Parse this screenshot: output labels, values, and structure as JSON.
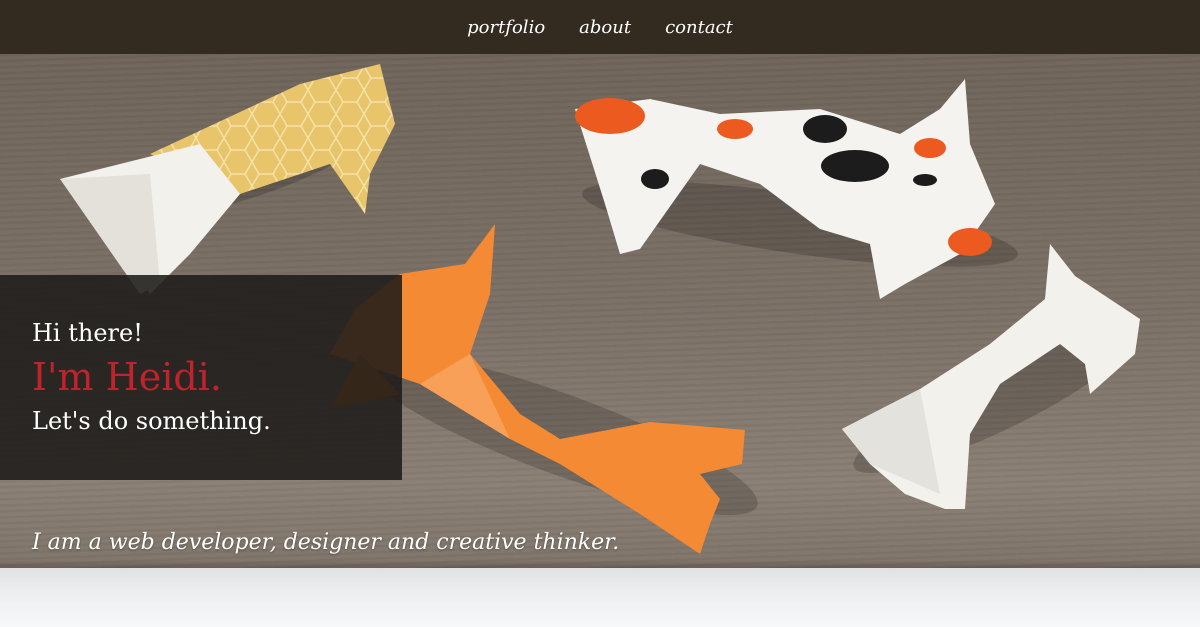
{
  "nav": {
    "items": [
      {
        "label": "portfolio"
      },
      {
        "label": "about"
      },
      {
        "label": "contact"
      }
    ]
  },
  "intro": {
    "greeting": "Hi there!",
    "name": "I'm Heidi.",
    "call_to_action": "Let's do something."
  },
  "tagline": "I am a web developer, designer and creative thinker.",
  "colors": {
    "nav_background": "#332a20",
    "name_accent": "#c0232c",
    "intro_box": "#1e1b19",
    "background_board": "#7a6e62"
  }
}
